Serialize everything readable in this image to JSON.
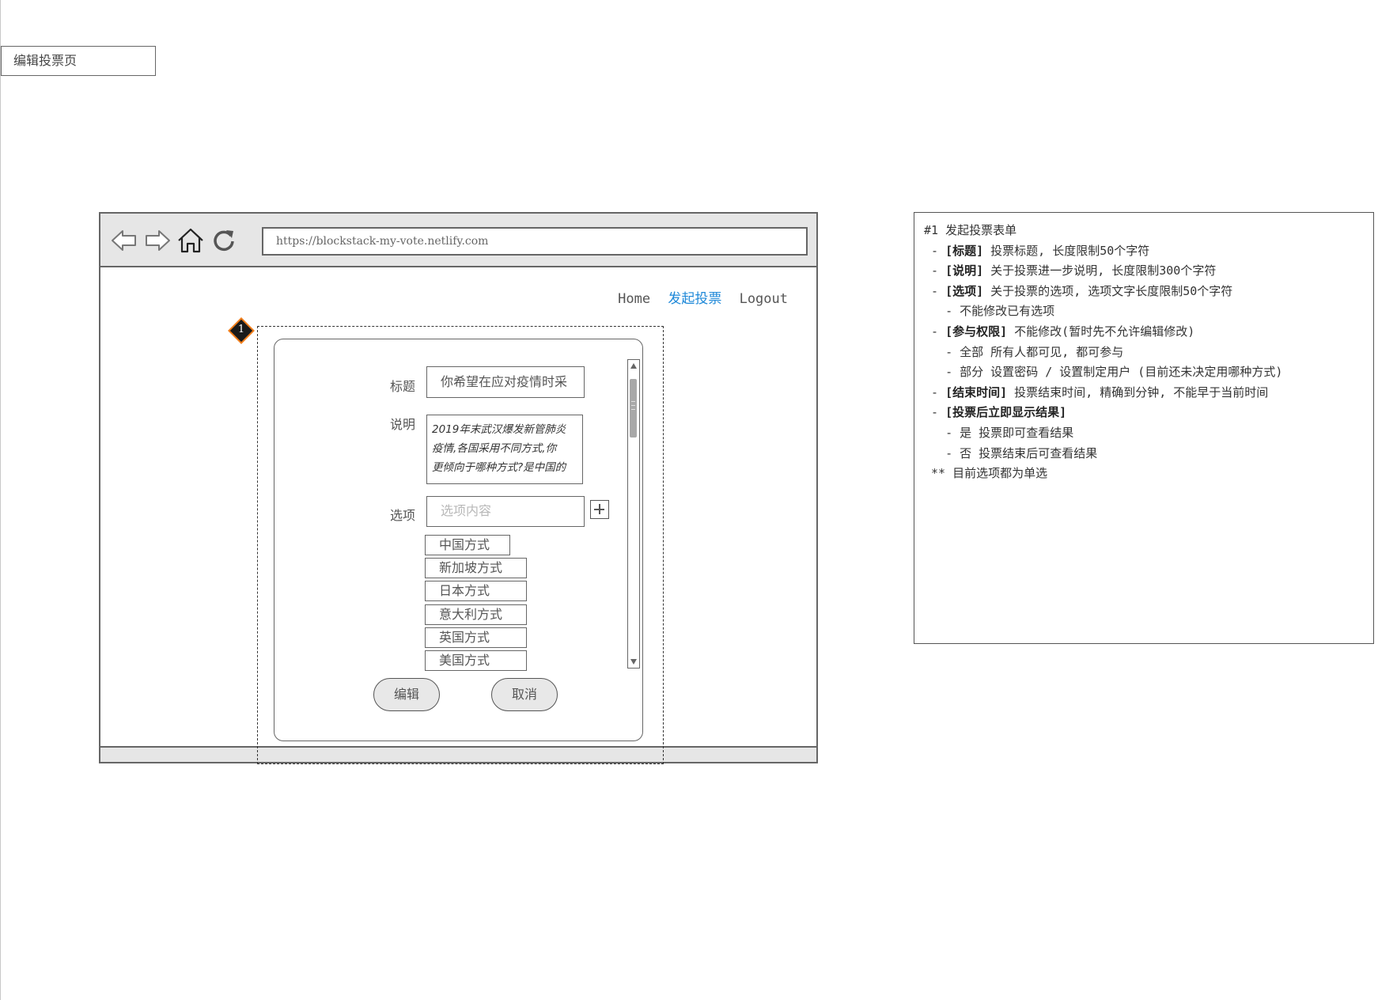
{
  "page_label": "编辑投票页",
  "browser": {
    "url": "https://blockstack-my-vote.netlify.com",
    "nav": {
      "home": "Home",
      "start_vote": "发起投票",
      "logout": "Logout"
    },
    "icons": [
      "back-arrow-icon",
      "forward-arrow-icon",
      "home-icon",
      "refresh-icon"
    ]
  },
  "marker_number": "1",
  "form": {
    "title_label": "标题",
    "title_value": "你希望在应对疫情时采",
    "description_label": "说明",
    "description_lines": [
      "2019年末武汉爆发新管肺炎",
      "疫情,各国采用不同方式,你",
      "更倾向于哪种方式?是中国的"
    ],
    "options_label": "选项",
    "options_placeholder": "选项内容",
    "options": [
      "中国方式",
      "新加坡方式",
      "日本方式",
      "意大利方式",
      "英国方式",
      "美国方式"
    ],
    "edit_button": "编辑",
    "cancel_button": "取消"
  },
  "notes": {
    "heading": "#1 发起投票表单",
    "items": [
      {
        "prefix": " - ",
        "key": "[标题]",
        "text": " 投票标题, 长度限制50个字符"
      },
      {
        "prefix": " - ",
        "key": "[说明]",
        "text": " 关于投票进一步说明, 长度限制300个字符"
      },
      {
        "prefix": " - ",
        "key": "[选项]",
        "text": " 关于投票的选项, 选项文字长度限制50个字符"
      },
      {
        "prefix": "   - ",
        "key": "",
        "text": "不能修改已有选项"
      },
      {
        "prefix": " - ",
        "key": "[参与权限]",
        "text": " 不能修改(暂时先不允许编辑修改)"
      },
      {
        "prefix": "   - ",
        "key": "",
        "text": "全部 所有人都可见, 都可参与"
      },
      {
        "prefix": "   - ",
        "key": "",
        "text": "部分 设置密码 / 设置制定用户 (目前还未决定用哪种方式)"
      },
      {
        "prefix": " - ",
        "key": "[结束时间]",
        "text": " 投票结束时间, 精确到分钟, 不能早于当前时间"
      },
      {
        "prefix": " - ",
        "key": "[投票后立即显示结果]",
        "text": ""
      },
      {
        "prefix": "   - ",
        "key": "",
        "text": "是 投票即可查看结果"
      },
      {
        "prefix": "   - ",
        "key": "",
        "text": "否 投票结束后可查看结果"
      },
      {
        "prefix": "",
        "key": "",
        "text": " ** 目前选项都为单选"
      }
    ]
  }
}
